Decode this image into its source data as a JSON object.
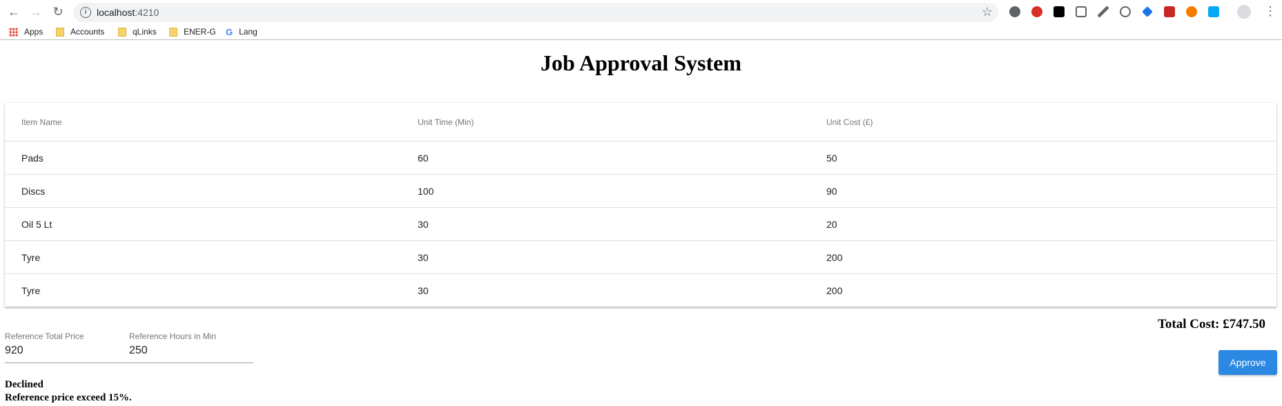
{
  "browser": {
    "url_host": "localhost",
    "url_port": ":4210",
    "bookmarks": [
      {
        "label": "Apps"
      },
      {
        "label": "Accounts"
      },
      {
        "label": "qLinks"
      },
      {
        "label": "ENER-G"
      },
      {
        "label": "Lang"
      }
    ],
    "extension_colors": [
      "#5f6368",
      "#d93025",
      "#000000",
      "#5f6368",
      "#5f6368",
      "#5f6368",
      "#1a73e8",
      "#c62828",
      "#f57c00",
      "#03a9f4"
    ]
  },
  "page": {
    "title": "Job Approval System"
  },
  "table": {
    "headers": [
      "Item Name",
      "Unit Time (Min)",
      "Unit Cost (£)"
    ],
    "rows": [
      [
        "Pads",
        "60",
        "50"
      ],
      [
        "Discs",
        "100",
        "90"
      ],
      [
        "Oil 5 Lt",
        "30",
        "20"
      ],
      [
        "Tyre",
        "30",
        "200"
      ],
      [
        "Tyre",
        "30",
        "200"
      ]
    ]
  },
  "summary": {
    "total_cost": "Total Cost: £747.50"
  },
  "form": {
    "reference_price_label": "Reference Total Price",
    "reference_price_value": "920",
    "reference_hours_label": "Reference Hours in Min",
    "reference_hours_value": "250",
    "approve_label": "Approve"
  },
  "status": {
    "result": "Declined",
    "reason": "Reference price exceed 15%."
  }
}
